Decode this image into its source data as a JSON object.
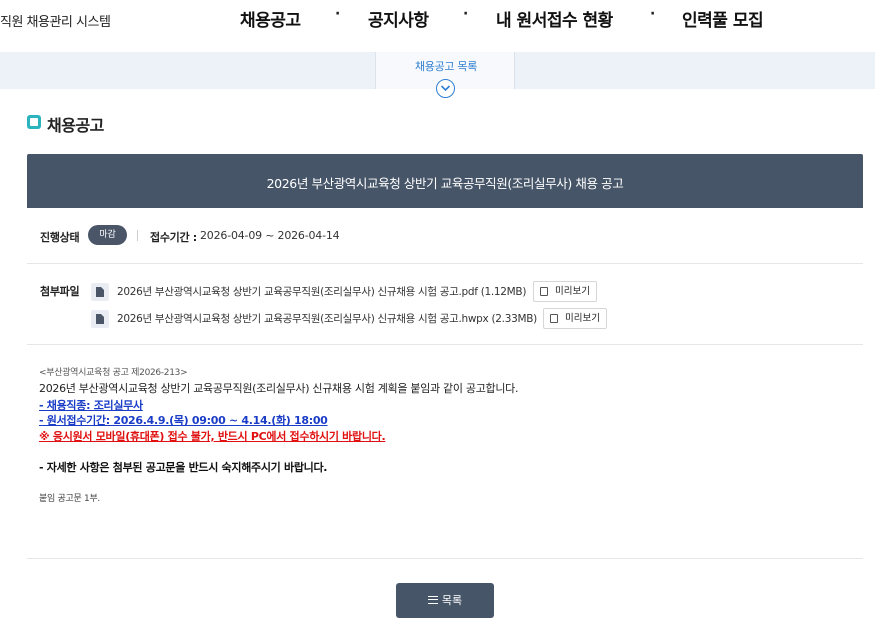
{
  "header": {
    "site_title": "직원 채용관리 시스템",
    "nav": [
      {
        "label": "채용공고"
      },
      {
        "label": "공지사항"
      },
      {
        "label": "내 원서접수 현황"
      },
      {
        "label": "인력풀 모집"
      }
    ],
    "separator": "·"
  },
  "subnav": {
    "tab_label": "채용공고 목록"
  },
  "section": {
    "title": "채용공고"
  },
  "notice": {
    "title": "2026년 부산광역시교육청 상반기 교육공무직원(조리실무사) 채용 공고",
    "status_label": "진행상태",
    "status_badge": "마감",
    "period_label": "접수기간 :",
    "period_value": "2026-04-09 ~ 2026-04-14",
    "attachments_label": "첨부파일",
    "attachments": [
      {
        "name": "2026년 부산광역시교육청 상반기 교육공무직원(조리실무사) 신규채용 시험 공고.pdf (1.12MB)",
        "preview": "미리보기"
      },
      {
        "name": "2026년 부산광역시교육청 상반기 교육공무직원(조리실무사) 신규채용 시험 공고.hwpx (2.33MB)",
        "preview": "미리보기"
      }
    ],
    "body": {
      "notice_no": "<부산광역시교육청 공고 제2026-213>",
      "intro": "2026년 부산광역시교육청 상반기 교육공무직원(조리실무사) 신규채용 시험 계획을 붙임과 같이 공고합니다.",
      "job": "- 채용직종: 조리실무사",
      "period": "- 원서접수기간: 2026.4.9.(목) 09:00 ~ 4.14.(화) 18:00",
      "warning": "※ 응시원서 모바일(휴대폰) 접수 불가, 반드시 PC에서 접수하시기 바랍니다.",
      "detail": "- 자세한 사항은 첨부된 공고문을 반드시 숙지해주시기 바랍니다.",
      "attach_note": "붙임  공고문 1부."
    }
  },
  "list_button": "목록",
  "colors": {
    "banner": "#475569",
    "accent_blue": "#2f7fd2",
    "link_blue": "#1a3cc7",
    "warning_red": "#e01010",
    "section_icon": "#2bb3c0"
  }
}
